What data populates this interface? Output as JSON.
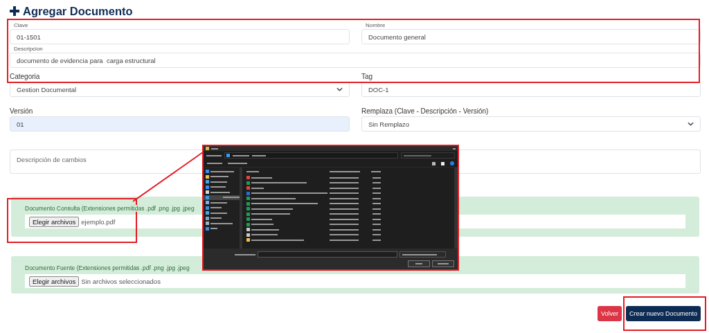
{
  "title": "Agregar Documento",
  "clave": {
    "label": "Clave",
    "value": "01-1501"
  },
  "nombre": {
    "label": "Nombre",
    "value": "Documento general"
  },
  "descripcion": {
    "label": "Descripcion",
    "value": "documento de evidencia para  carga estructural"
  },
  "categoria": {
    "label": "Categoria",
    "value": "Gestion Documental"
  },
  "tag": {
    "label": "Tag",
    "value": "DOC-1"
  },
  "version": {
    "label": "Versión",
    "value": "01"
  },
  "remplaza": {
    "label": "Remplaza (Clave - Descripción - Versión)",
    "value": "Sin Remplazo"
  },
  "descripcion_cambios": {
    "placeholder": "Descripción de cambios"
  },
  "uploads": [
    {
      "label": "Documento Consulta (Extensiones permitidas .pdf .png .jpg .jpeg",
      "button": "Elegir archivos",
      "status": "ejemplo.pdf"
    },
    {
      "label": "Documento Fuente (Extensiones permitidas .pdf .png .jpg .jpeg",
      "button": "Elegir archivos",
      "status": "Sin archivos seleccionados"
    }
  ],
  "buttons": [
    {
      "kind": "danger",
      "label": "Volver"
    },
    {
      "kind": "primary",
      "label": "Crear nuevo Documento"
    }
  ]
}
